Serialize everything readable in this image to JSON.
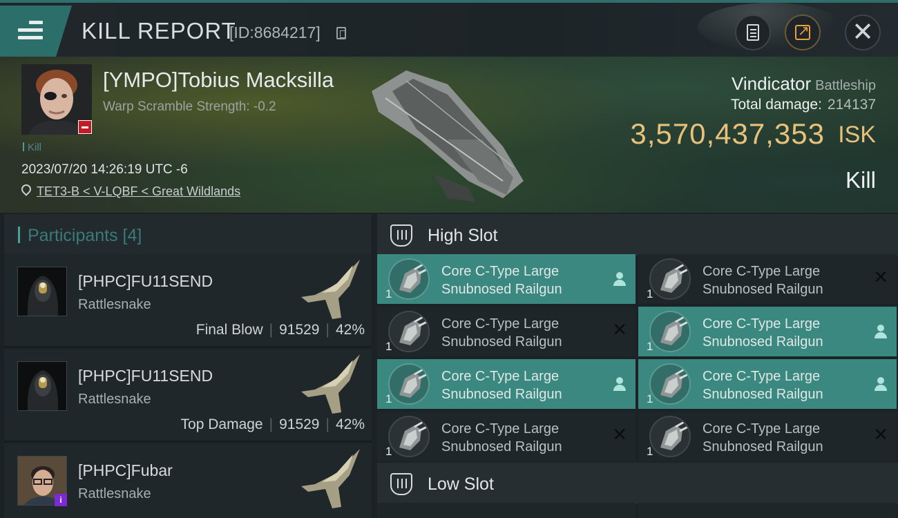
{
  "header": {
    "title": "KILL REPORT",
    "report_id": "[ID:8684217]"
  },
  "victim": {
    "name": "[YMPO]Tobius Macksilla",
    "warp_scramble": "Warp Scramble Strength: -0.2",
    "tag": "Kill",
    "datetime": "2023/07/20 14:26:19 UTC -6",
    "location": "TET3-B < V-LQBF < Great Wildlands",
    "ship_name": "Vindicator",
    "ship_class": "Battleship",
    "total_damage_label": "Total damage:",
    "total_damage": "214137",
    "isk_value": "3,570,437,353",
    "isk_unit": "ISK",
    "result": "Kill"
  },
  "participants": {
    "title": "Participants [4]",
    "rows": [
      {
        "name": "[PHPC]FU11SEND",
        "ship": "Rattlesnake",
        "role": "Final Blow",
        "damage": "91529",
        "percent": "42%"
      },
      {
        "name": "[PHPC]FU11SEND",
        "ship": "Rattlesnake",
        "role": "Top Damage",
        "damage": "91529",
        "percent": "42%"
      },
      {
        "name": "[PHPC]Fubar",
        "ship": "Rattlesnake",
        "role": "",
        "damage": "",
        "percent": ""
      }
    ],
    "badge_info": "i"
  },
  "slots": {
    "high_title": "High Slot",
    "low_title": "Low Slot",
    "module_line1": "Core C-Type Large",
    "module_line2": "Snubnosed Railgun",
    "module_qty": "1",
    "high_modules": [
      {
        "state": "dropped"
      },
      {
        "state": "destroyed"
      },
      {
        "state": "destroyed"
      },
      {
        "state": "dropped"
      },
      {
        "state": "dropped"
      },
      {
        "state": "dropped"
      },
      {
        "state": "destroyed"
      },
      {
        "state": "destroyed"
      }
    ],
    "icons": {
      "dropped": "person-icon",
      "destroyed": "x-icon"
    }
  },
  "colors": {
    "accent_teal": "#3b8880",
    "isk_gold": "#e8c27a",
    "destroyed_badge": "#c21d24"
  }
}
